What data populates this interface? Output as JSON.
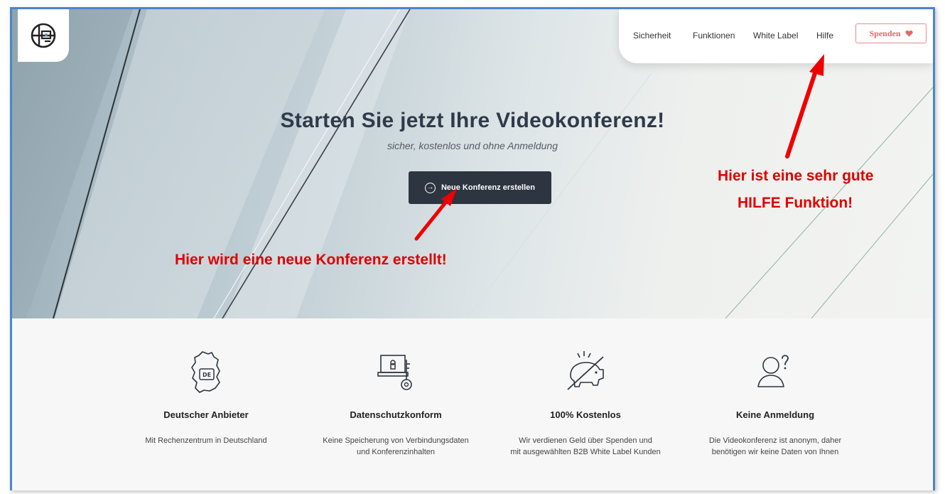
{
  "nav": {
    "items": [
      "Sicherheit",
      "Funktionen",
      "White Label",
      "Hilfe"
    ],
    "donate_label": "Spenden",
    "donate_icon": "heart-icon"
  },
  "hero": {
    "title": "Starten Sie jetzt Ihre Videokonferenz!",
    "subtitle": "sicher, kostenlos und ohne Anmeldung",
    "cta_label": "Neue Konferenz erstellen"
  },
  "annotations": {
    "help_line1": "Hier ist eine sehr gute",
    "help_line2": "HILFE Funktion!",
    "cta": "Hier wird eine neue Konferenz erstellt!"
  },
  "features": [
    {
      "icon": "germany-map-icon",
      "badge": "DE",
      "title": "Deutscher Anbieter",
      "line1": "Mit Rechenzentrum in Deutschland",
      "line2": ""
    },
    {
      "icon": "laptop-lock-key-icon",
      "title": "Datenschutzkonform",
      "line1": "Keine Speicherung von Verbindungsdaten",
      "line2": "und Konferenzinhalten"
    },
    {
      "icon": "crossed-piggy-bank-icon",
      "title": "100% Kostenlos",
      "line1": "Wir verdienen Geld über Spenden und",
      "line2": "mit ausgewählten B2B White Label Kunden"
    },
    {
      "icon": "person-question-icon",
      "title": "Keine Anmeldung",
      "line1": "Die Videokonferenz ist anonym, daher",
      "line2": "benötigen wir keine Daten von Ihnen"
    }
  ],
  "colors": {
    "annotation": "#e00000",
    "cta_bg": "#2d3540",
    "donate": "#e46767",
    "frame": "#4a86c8"
  }
}
